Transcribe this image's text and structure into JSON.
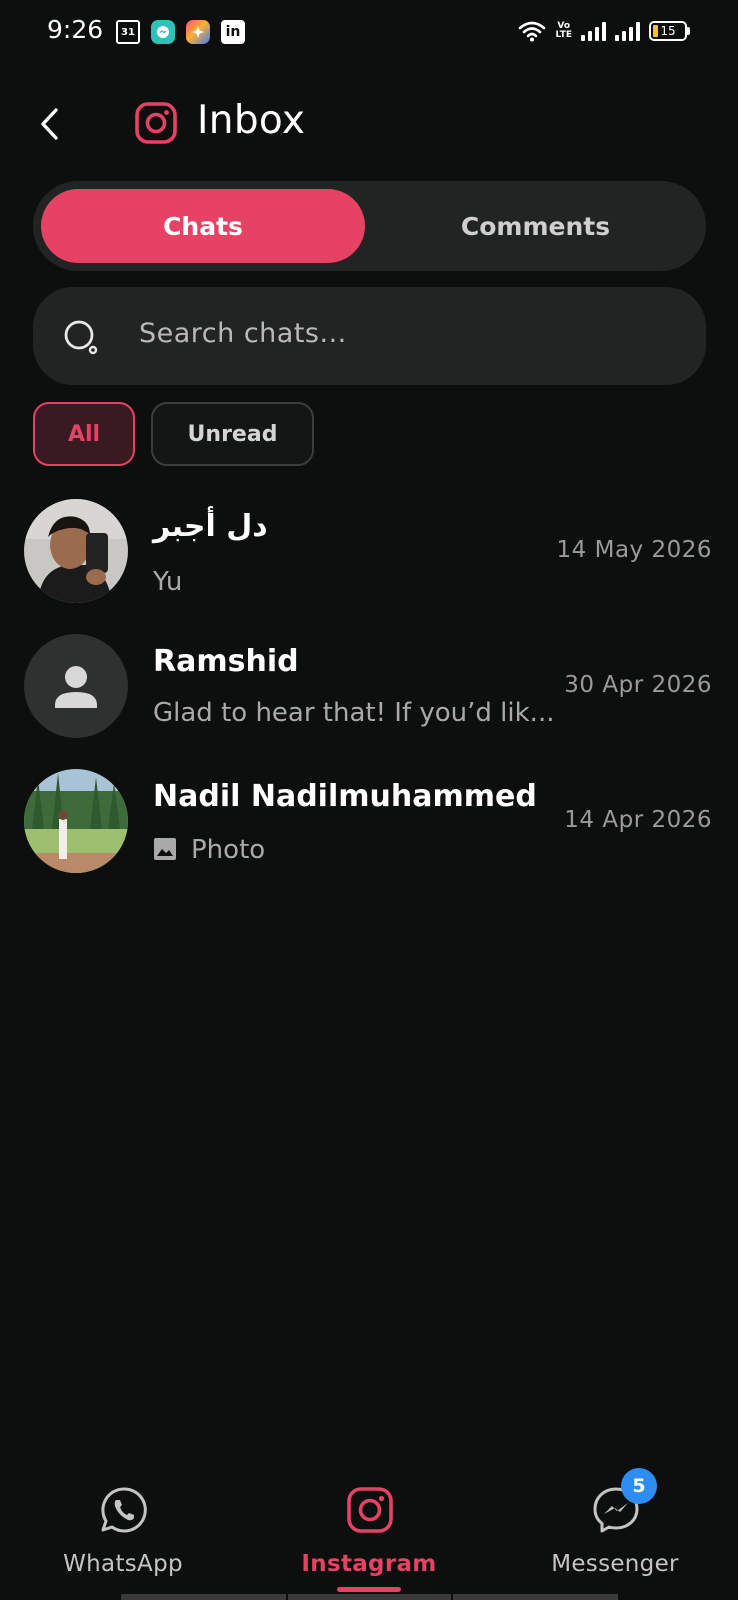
{
  "status_bar": {
    "time": "9:26",
    "calendar_day": "31",
    "linkedin_label": "in",
    "volte_label": "Vo\nLTE",
    "battery_level": "15"
  },
  "header": {
    "title": "Inbox",
    "logo_icon": "instagram-icon",
    "back_icon": "chevron-left-icon",
    "accent_color": "#e54264"
  },
  "tabs": [
    {
      "label": "Chats",
      "active": true
    },
    {
      "label": "Comments",
      "active": false
    }
  ],
  "search": {
    "placeholder": "Search chats..."
  },
  "filters": [
    {
      "label": "All",
      "active": true
    },
    {
      "label": "Unread",
      "active": false
    }
  ],
  "chats": [
    {
      "name": "دل أجبر",
      "preview": "Yu",
      "date": "14 May 2026",
      "avatar": "photo"
    },
    {
      "name": "Ramshid",
      "preview": "Glad to hear that! If you’d lik...",
      "date": "30 Apr 2026",
      "avatar": "default-person-icon"
    },
    {
      "name": "Nadil Nadilmuhammed",
      "preview": "Photo",
      "preview_icon": "image-icon",
      "date": "14 Apr 2026",
      "avatar": "photo"
    }
  ],
  "bottom_nav": [
    {
      "label": "WhatsApp",
      "icon": "whatsapp-icon",
      "active": false
    },
    {
      "label": "Instagram",
      "icon": "instagram-icon",
      "active": true
    },
    {
      "label": "Messenger",
      "icon": "messenger-icon",
      "active": false,
      "badge": "5"
    }
  ]
}
